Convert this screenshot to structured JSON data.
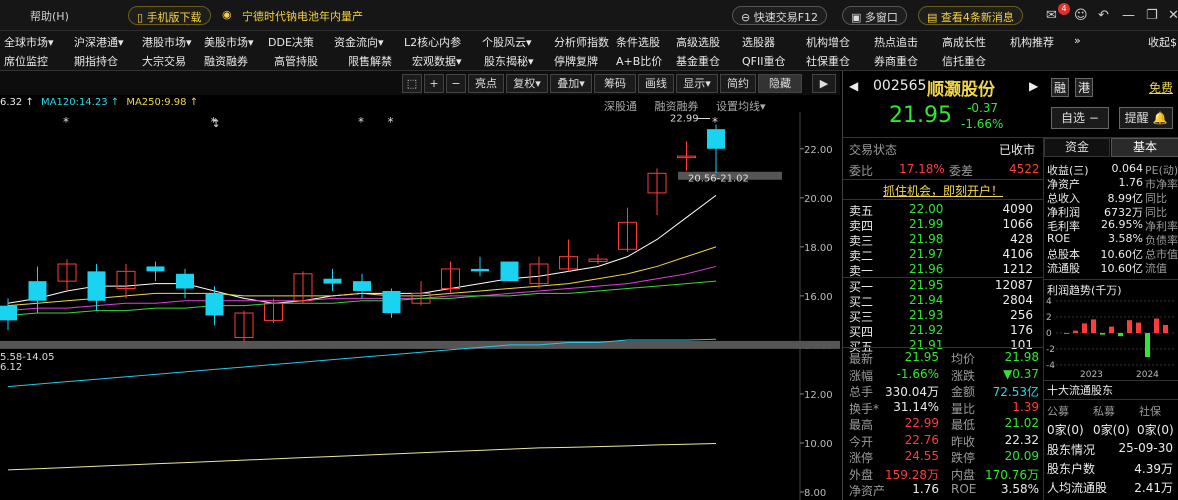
{
  "titlebar": {
    "help": "帮助(H)",
    "mobile_download": "手机版下载",
    "news_headline": "宁德时代钠电池年内量产",
    "quick_trade": "快速交易F12",
    "multi_window": "多窗口",
    "view_news": "查看4条新消息",
    "badge_count": "4"
  },
  "menu_row1": [
    "全球市场▾",
    "沪深港通▾",
    "港股市场▾",
    "美股市场▾",
    "DDE决策",
    "资金流向▾",
    "L2核心内参",
    "个股风云▾",
    "分析师指数",
    "条件选股",
    "高级选股",
    "选股器",
    "机构增仓",
    "热点追击",
    "高成长性",
    "机构推荐",
    "»",
    "收起$"
  ],
  "menu_row2": [
    "席位监控",
    "期指持仓",
    "大宗交易",
    "融资融券",
    "高管持股",
    "限售解禁",
    "宏观数据▾",
    "股东揭秘▾",
    "停牌复牌",
    "A+B比价",
    "基金重仓",
    "QFII重仓",
    "社保重仓",
    "券商重仓",
    "信托重仓"
  ],
  "chart_toolbar": {
    "buttons": [
      "亮点",
      "复权▾",
      "叠加▾",
      "筹码",
      "画线",
      "显示▾",
      "简约",
      "隐藏"
    ],
    "links": [
      "深股通",
      "融资融券",
      "设置均线▾"
    ]
  },
  "ma_legend": {
    "prefix": "6.32 ↑",
    "ma120": "MA120:14.23 ↑",
    "ma250": "MA250:9.98 ↑"
  },
  "chart_data": {
    "type": "candlestick",
    "ylim": [
      8.0,
      23.5
    ],
    "yticks": [
      "22.00",
      "20.00",
      "18.00",
      "16.00",
      "14.00",
      "12.00",
      "10.00",
      "8.00"
    ],
    "ytick_values": [
      22,
      20,
      18,
      16,
      14,
      12,
      10,
      8
    ],
    "annotations": {
      "high_label": "22.99",
      "range_label": "20.56-21.02",
      "low_label": "5.58-14.05",
      "left_cut": "6.12"
    },
    "candles": [
      {
        "o": 15.0,
        "c": 15.6,
        "h": 15.9,
        "l": 14.6,
        "up": false
      },
      {
        "o": 16.6,
        "c": 15.8,
        "h": 17.2,
        "l": 15.3,
        "up": false
      },
      {
        "o": 16.6,
        "c": 17.3,
        "h": 17.5,
        "l": 16.2,
        "up": true
      },
      {
        "o": 17.0,
        "c": 15.8,
        "h": 17.3,
        "l": 15.4,
        "up": false
      },
      {
        "o": 16.3,
        "c": 17.0,
        "h": 17.3,
        "l": 15.9,
        "up": true
      },
      {
        "o": 17.2,
        "c": 17.0,
        "h": 17.4,
        "l": 16.6,
        "up": false
      },
      {
        "o": 16.9,
        "c": 16.3,
        "h": 17.1,
        "l": 15.9,
        "up": false
      },
      {
        "o": 16.1,
        "c": 15.2,
        "h": 16.4,
        "l": 14.8,
        "up": false
      },
      {
        "o": 14.3,
        "c": 15.3,
        "h": 15.4,
        "l": 14.1,
        "up": true
      },
      {
        "o": 15.0,
        "c": 15.7,
        "h": 15.9,
        "l": 14.9,
        "up": true
      },
      {
        "o": 15.8,
        "c": 16.9,
        "h": 17.0,
        "l": 15.7,
        "up": true
      },
      {
        "o": 16.5,
        "c": 16.7,
        "h": 17.1,
        "l": 16.2,
        "up": false
      },
      {
        "o": 16.6,
        "c": 16.2,
        "h": 16.9,
        "l": 15.9,
        "up": false
      },
      {
        "o": 16.2,
        "c": 15.3,
        "h": 16.3,
        "l": 15.1,
        "up": false
      },
      {
        "o": 15.7,
        "c": 16.1,
        "h": 16.6,
        "l": 15.6,
        "up": true
      },
      {
        "o": 16.3,
        "c": 17.1,
        "h": 17.4,
        "l": 16.1,
        "up": true
      },
      {
        "o": 17.1,
        "c": 17.0,
        "h": 17.6,
        "l": 16.8,
        "up": false
      },
      {
        "o": 17.4,
        "c": 16.6,
        "h": 17.4,
        "l": 16.6,
        "up": false
      },
      {
        "o": 16.5,
        "c": 17.3,
        "h": 17.6,
        "l": 16.3,
        "up": true
      },
      {
        "o": 17.1,
        "c": 17.6,
        "h": 18.3,
        "l": 17.0,
        "up": true
      },
      {
        "o": 17.4,
        "c": 17.5,
        "h": 17.7,
        "l": 17.3,
        "up": true
      },
      {
        "o": 17.9,
        "c": 19.0,
        "h": 19.6,
        "l": 17.8,
        "up": true
      },
      {
        "o": 20.2,
        "c": 21.0,
        "h": 21.2,
        "l": 19.3,
        "up": true
      },
      {
        "o": 21.7,
        "c": 21.7,
        "h": 22.3,
        "l": 21.1,
        "up": true
      },
      {
        "o": 22.8,
        "c": 22.0,
        "h": 22.99,
        "l": 21.0,
        "up": false
      }
    ],
    "ma_lines": [
      {
        "name": "MA5",
        "color": "#ffffff",
        "values": [
          15.7,
          15.9,
          16.2,
          16.4,
          16.4,
          16.5,
          16.5,
          16.2,
          15.9,
          15.7,
          15.8,
          16.0,
          16.1,
          16.1,
          16.1,
          16.3,
          16.5,
          16.7,
          16.8,
          17.0,
          17.2,
          17.6,
          18.3,
          19.2,
          20.1
        ]
      },
      {
        "name": "MA10",
        "color": "#f0d648",
        "values": [
          15.6,
          15.7,
          15.8,
          15.9,
          16.0,
          16.1,
          16.1,
          16.1,
          16.0,
          16.0,
          16.0,
          16.0,
          16.1,
          16.0,
          16.0,
          16.1,
          16.2,
          16.3,
          16.4,
          16.5,
          16.7,
          16.9,
          17.2,
          17.6,
          18.0
        ]
      },
      {
        "name": "MA20",
        "color": "#e040e0",
        "values": [
          15.4,
          15.5,
          15.5,
          15.6,
          15.7,
          15.7,
          15.8,
          15.8,
          15.8,
          15.8,
          15.8,
          15.9,
          15.9,
          15.9,
          15.9,
          16.0,
          16.0,
          16.1,
          16.2,
          16.3,
          16.4,
          16.5,
          16.7,
          16.9,
          17.2
        ]
      },
      {
        "name": "MA60",
        "color": "#3ad53a",
        "values": [
          15.2,
          15.3,
          15.3,
          15.4,
          15.4,
          15.5,
          15.5,
          15.6,
          15.6,
          15.7,
          15.7,
          15.7,
          15.8,
          15.8,
          15.9,
          15.9,
          16.0,
          16.0,
          16.1,
          16.1,
          16.2,
          16.3,
          16.4,
          16.5,
          16.6
        ]
      },
      {
        "name": "MA120",
        "color": "#29c6e6",
        "values": [
          12.3,
          12.4,
          12.5,
          12.6,
          12.7,
          12.8,
          12.9,
          13.0,
          13.1,
          13.2,
          13.3,
          13.4,
          13.5,
          13.6,
          13.7,
          13.8,
          13.9,
          14.0,
          14.0,
          14.1,
          14.1,
          14.2,
          14.2,
          14.2,
          14.23
        ]
      },
      {
        "name": "MA250",
        "color": "#e8e89a",
        "values": [
          8.9,
          8.95,
          9.0,
          9.05,
          9.1,
          9.15,
          9.2,
          9.25,
          9.3,
          9.35,
          9.4,
          9.45,
          9.5,
          9.55,
          9.6,
          9.65,
          9.7,
          9.75,
          9.8,
          9.82,
          9.85,
          9.88,
          9.92,
          9.95,
          9.98
        ]
      }
    ],
    "star_markers": [
      2,
      7,
      12,
      13,
      24
    ],
    "arrow_marker": 7
  },
  "stock": {
    "code": "002565",
    "name": "顺灏股份",
    "tag1": "融",
    "tag2": "港",
    "free_label": "免费",
    "price": "21.95",
    "change": "-0.37",
    "change_pct": "-1.66%",
    "select_btn": "自选",
    "alert_btn": "提醒",
    "status_label": "交易状态",
    "status_value": "已收市",
    "weibi_label": "委比",
    "weibi_value": "17.18%",
    "weicha_label": "委差",
    "weicha_value": "4522",
    "promo": "抓住机会，即刻开户！"
  },
  "order_book": {
    "asks": [
      {
        "label": "卖五",
        "price": "22.00",
        "vol": "4090"
      },
      {
        "label": "卖四",
        "price": "21.99",
        "vol": "1066"
      },
      {
        "label": "卖三",
        "price": "21.98",
        "vol": "428"
      },
      {
        "label": "卖二",
        "price": "21.97",
        "vol": "4106"
      },
      {
        "label": "卖一",
        "price": "21.96",
        "vol": "1212"
      }
    ],
    "bids": [
      {
        "label": "买一",
        "price": "21.95",
        "vol": "12087"
      },
      {
        "label": "买二",
        "price": "21.94",
        "vol": "2804"
      },
      {
        "label": "买三",
        "price": "21.93",
        "vol": "256"
      },
      {
        "label": "买四",
        "price": "21.92",
        "vol": "176"
      },
      {
        "label": "买五",
        "price": "21.91",
        "vol": "101"
      }
    ]
  },
  "quote_stats": [
    {
      "l1": "最新",
      "v1": "21.95",
      "c1": "green",
      "l2": "均价",
      "v2": "21.98",
      "c2": "green"
    },
    {
      "l1": "涨幅",
      "v1": "-1.66%",
      "c1": "green",
      "l2": "涨跌",
      "v2": "▼0.37",
      "c2": "green"
    },
    {
      "l1": "总手",
      "v1": "330.04万",
      "c1": "white",
      "l2": "金额",
      "v2": "72.53亿",
      "c2": "cyan"
    },
    {
      "l1": "换手*",
      "v1": "31.14%",
      "c1": "white",
      "l2": "量比",
      "v2": "1.39",
      "c2": "red"
    },
    {
      "l1": "最高",
      "v1": "22.99",
      "c1": "red",
      "l2": "最低",
      "v2": "21.02",
      "c2": "green"
    },
    {
      "l1": "今开",
      "v1": "22.76",
      "c1": "red",
      "l2": "昨收",
      "v2": "22.32",
      "c2": "white"
    },
    {
      "l1": "涨停",
      "v1": "24.55",
      "c1": "red",
      "l2": "跌停",
      "v2": "20.09",
      "c2": "green"
    },
    {
      "l1": "外盘",
      "v1": "159.28万",
      "c1": "red",
      "l2": "内盘",
      "v2": "170.76万",
      "c2": "green"
    },
    {
      "l1": "净资产",
      "v1": "1.76",
      "c1": "white",
      "l2": "ROE",
      "v2": "3.58%",
      "c2": "white"
    }
  ],
  "fund_tabs": [
    "资金",
    "基本"
  ],
  "fundamentals": [
    {
      "label": "收益(三)",
      "value": "0.064",
      "extra": "PE(动)"
    },
    {
      "label": "净资产",
      "value": "1.76",
      "extra": "市净率"
    },
    {
      "label": "总收入",
      "value": "8.99亿",
      "extra": "同比"
    },
    {
      "label": "净利润",
      "value": "6732万",
      "extra": "同比"
    },
    {
      "label": "毛利率",
      "value": "26.95%",
      "extra": "净利率"
    },
    {
      "label": "ROE",
      "value": "3.58%",
      "extra": "负债率"
    },
    {
      "label": "总股本",
      "value": "10.60亿",
      "extra": "总市值"
    },
    {
      "label": "流通股",
      "value": "10.60亿",
      "extra": "流值"
    }
  ],
  "profit_trend": {
    "title": "利润趋势(千万)",
    "y_labels": [
      "4",
      "2",
      "0",
      "-2",
      "-4"
    ],
    "x_labels": [
      "2023",
      "2024"
    ],
    "bars": [
      0,
      0.3,
      1.2,
      1.7,
      -0.2,
      0.8,
      -0.4,
      1.6,
      1.3,
      -3.0,
      1.8,
      1.0
    ]
  },
  "holders": {
    "title": "十大流通股东",
    "cols": [
      "公募",
      "私募",
      "社保"
    ],
    "counts": [
      "0家(0)",
      "0家(0)",
      "0家(0)"
    ],
    "rows": [
      {
        "label": "股东情况",
        "value": "25-09-30"
      },
      {
        "label": "股东户数",
        "value": "4.39万"
      },
      {
        "label": "人均流通股",
        "value": "2.41万"
      }
    ]
  }
}
